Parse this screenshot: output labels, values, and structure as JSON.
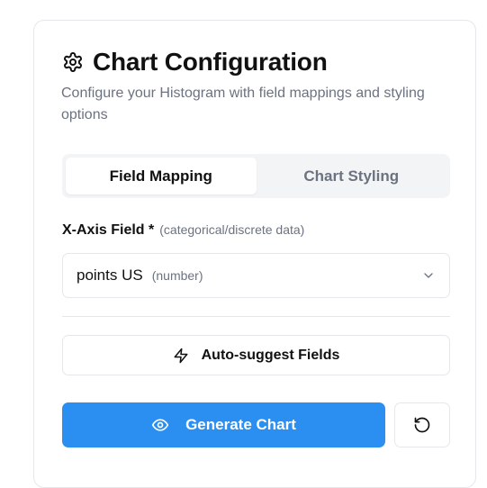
{
  "header": {
    "icon": "settings-gear-icon",
    "title": "Chart Configuration",
    "subtitle": "Configure your Histogram with field mappings and styling options"
  },
  "tabs": [
    {
      "label": "Field Mapping",
      "active": true
    },
    {
      "label": "Chart Styling",
      "active": false
    }
  ],
  "xaxis": {
    "label": "X-Axis Field *",
    "hint": "(categorical/discrete data)",
    "selected_value": "points US",
    "selected_type": "(number)",
    "icon": "chevron-down-icon"
  },
  "actions": {
    "auto_suggest_label": "Auto-suggest Fields",
    "auto_suggest_icon": "lightning-icon",
    "generate_label": "Generate Chart",
    "generate_icon": "eye-icon",
    "reset_icon": "rotate-ccw-icon"
  },
  "colors": {
    "primary": "#2a8ff0",
    "border": "#e5e7eb",
    "muted_text": "#6b7280",
    "tab_bg": "#f3f4f6"
  }
}
